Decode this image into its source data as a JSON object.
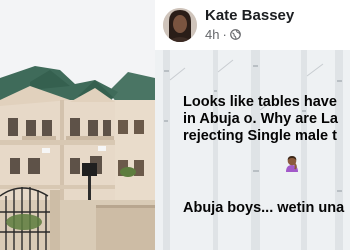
{
  "post": {
    "author_name": "Kate Bassey",
    "timestamp": "4h",
    "dot": "·",
    "audience_icon": "globe-icon",
    "text_lines": {
      "line1": "Looks like tables have",
      "line2": "in Abuja o. Why are La",
      "line3": "rejecting Single male t"
    },
    "text_line_4": "Abuja boys... wetin una",
    "emoji": "person-facepalming-icon",
    "background_color": "#eef1f3"
  },
  "colors": {
    "author": "#1c1e21",
    "meta": "#65676b",
    "roof": "#3f6b5a",
    "wall": "#e7d9c8"
  }
}
